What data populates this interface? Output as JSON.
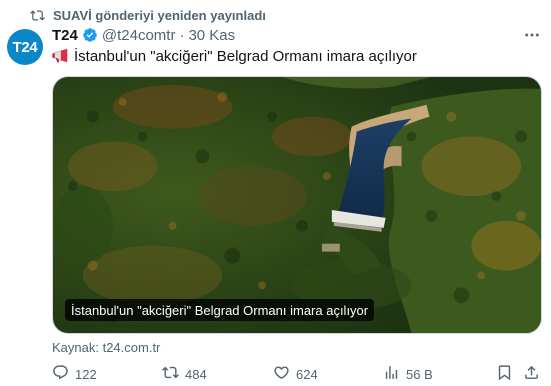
{
  "repost": {
    "text": "SUAVİ gönderiyi yeniden yayınladı"
  },
  "author": {
    "avatar_text": "T24",
    "name": "T24",
    "handle": "@t24comtr",
    "separator": "·",
    "time": "30 Kas"
  },
  "tweet": {
    "text": "İstanbul'un \"akciğeri\" Belgrad Ormanı imara açılıyor"
  },
  "card": {
    "overlay_title": "İstanbul'un \"akciğeri\" Belgrad Ormanı imara açılıyor",
    "source": "Kaynak: t24.com.tr"
  },
  "actions": {
    "replies": "122",
    "reposts": "484",
    "likes": "624",
    "views": "56 B"
  },
  "colors": {
    "accent": "#1d9bf0",
    "repost_green": "#00ba7c",
    "muted_text": "#536471",
    "avatar_bg": "#0a86c9"
  },
  "icons": {
    "repost": "repost-icon",
    "verified": "verified-badge-icon",
    "more": "more-icon",
    "megaphone": "megaphone-emoji-icon",
    "reply": "reply-icon",
    "like": "heart-icon",
    "views": "views-icon",
    "bookmark": "bookmark-icon",
    "share": "share-icon"
  }
}
